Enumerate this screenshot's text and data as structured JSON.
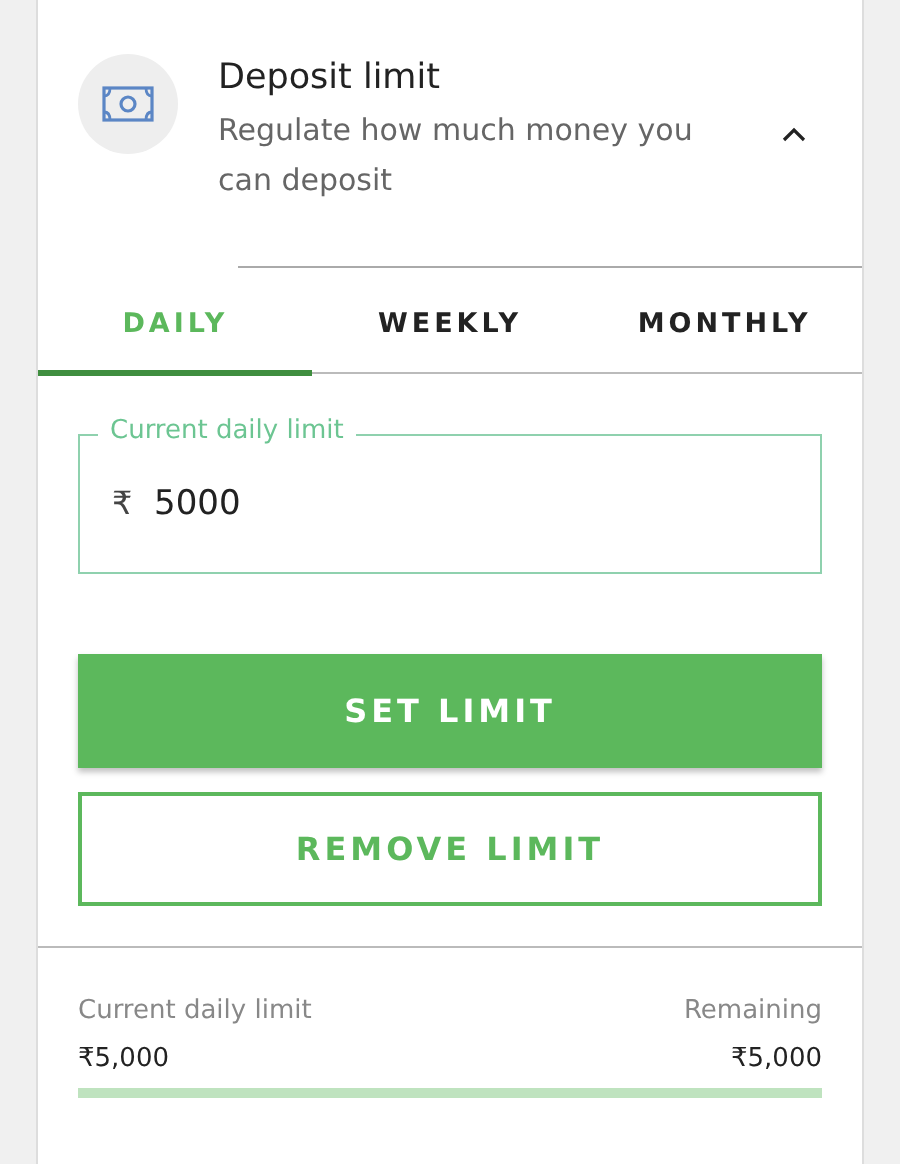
{
  "panel": {
    "title": "Deposit limit",
    "subtitle": "Regulate how much money you can deposit",
    "expanded": true
  },
  "tabs": [
    {
      "label": "DAILY",
      "selected": true
    },
    {
      "label": "WEEKLY",
      "selected": false
    },
    {
      "label": "MONTHLY",
      "selected": false
    }
  ],
  "limit_field": {
    "label": "Current daily limit",
    "currency": "₹",
    "value": "5000"
  },
  "buttons": [
    {
      "label": "SET LIMIT",
      "kind": "primary"
    },
    {
      "label": "REMOVE LIMIT",
      "kind": "outline"
    }
  ],
  "summary": {
    "left_label": "Current daily limit",
    "left_value": "₹5,000",
    "right_label": "Remaining",
    "right_value": "₹5,000",
    "level": 1
  }
}
